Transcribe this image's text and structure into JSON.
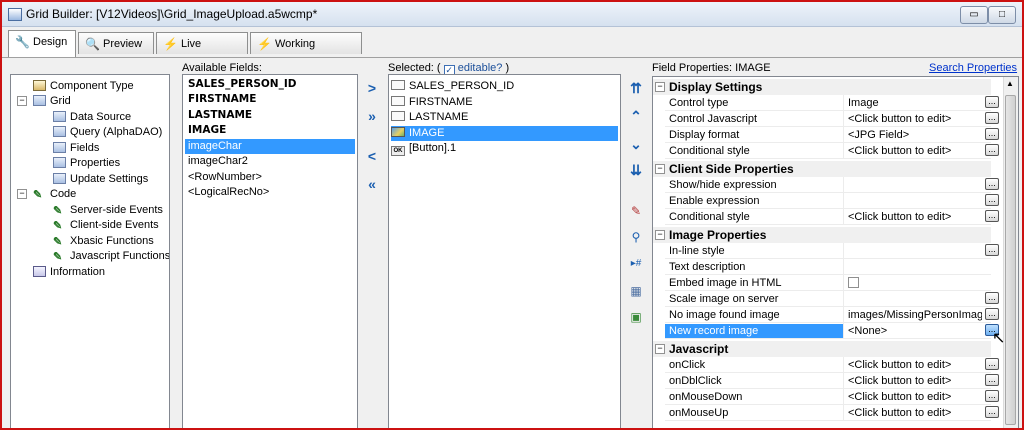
{
  "window": {
    "title": "Grid Builder: [V12Videos]\\Grid_ImageUpload.a5wcmp*",
    "buttons": [
      "▭",
      "□",
      "✕"
    ]
  },
  "tabs": [
    {
      "label": "Design",
      "icon": "wrench-icon",
      "active": true
    },
    {
      "label": "Preview",
      "icon": "preview-icon",
      "active": false
    },
    {
      "label": "Live Preview",
      "icon": "lightning-icon",
      "active": false
    },
    {
      "label": "Working Preview",
      "icon": "lightning-icon",
      "active": false
    }
  ],
  "tree": {
    "items": [
      {
        "label": "Component Type",
        "icon": "component-icon"
      },
      {
        "label": "Grid",
        "icon": "grid-icon"
      },
      {
        "label": "Data Source",
        "icon": "grid-icon"
      },
      {
        "label": "Query (AlphaDAO)",
        "icon": "grid-icon"
      },
      {
        "label": "Fields",
        "icon": "grid-icon"
      },
      {
        "label": "Properties",
        "icon": "grid-icon"
      },
      {
        "label": "Update Settings",
        "icon": "grid-icon"
      },
      {
        "label": "Code",
        "icon": "code-icon"
      },
      {
        "label": "Server-side Events",
        "icon": "code-icon"
      },
      {
        "label": "Client-side Events",
        "icon": "code-icon"
      },
      {
        "label": "Xbasic Functions",
        "icon": "code-icon"
      },
      {
        "label": "Javascript Functions",
        "icon": "code-icon"
      },
      {
        "label": "Information",
        "icon": "info-icon"
      }
    ]
  },
  "available": {
    "header": "Available Fields:",
    "items": [
      "SALES_PERSON_ID",
      "FIRSTNAME",
      "LASTNAME",
      "IMAGE",
      "imageChar",
      "imageChar2",
      "<RowNumber>",
      "<LogicalRecNo>"
    ]
  },
  "move_buttons": [
    ">",
    "»",
    "<",
    "«"
  ],
  "selected": {
    "header_prefix": "Selected: (",
    "editable_label": "editable?",
    "header_suffix": ")",
    "items": [
      "SALES_PERSON_ID",
      "FIRSTNAME",
      "LASTNAME",
      "IMAGE",
      "[Button].1"
    ]
  },
  "order_buttons": [
    "⇈",
    "⌃",
    "⌄",
    "⇊"
  ],
  "tool_icons": [
    "magic-wand-icon",
    "zoom-icon",
    "hash-icon",
    "grid-icon",
    "book-icon"
  ],
  "tool_glyphs": [
    "✎",
    "⚲",
    "▸#",
    "▦",
    "▣"
  ],
  "field_properties": {
    "header": "Field Properties: IMAGE",
    "search_label": "Search Properties",
    "ellipsis": "...",
    "sections": [
      {
        "title": "Display Settings",
        "rows": [
          {
            "name": "Control type",
            "value": "Image",
            "button": true
          },
          {
            "name": "Control Javascript",
            "value": "<Click button to edit>",
            "button": true
          },
          {
            "name": "Display format",
            "value": "<JPG Field>",
            "button": true
          },
          {
            "name": "Conditional style",
            "value": "<Click button to edit>",
            "button": true
          }
        ]
      },
      {
        "title": "Client Side Properties",
        "rows": [
          {
            "name": "Show/hide expression",
            "value": "",
            "button": true
          },
          {
            "name": "Enable expression",
            "value": "",
            "button": true
          },
          {
            "name": "Conditional style",
            "value": "<Click button to edit>",
            "button": true
          }
        ]
      },
      {
        "title": "Image Properties",
        "rows": [
          {
            "name": "In-line style",
            "value": "",
            "button": true
          },
          {
            "name": "Text description",
            "value": "",
            "button": false
          },
          {
            "name": "Embed image in HTML",
            "value": "",
            "button": false,
            "checkbox": true
          },
          {
            "name": "Scale image on server",
            "value": "",
            "button": true
          },
          {
            "name": "No image found image",
            "value": "images/MissingPersonImage.j",
            "button": true
          },
          {
            "name": "New record image",
            "value": "<None>",
            "button": true,
            "highlighted": true
          }
        ]
      },
      {
        "title": "Javascript",
        "rows": [
          {
            "name": "onClick",
            "value": "<Click button to edit>",
            "button": true
          },
          {
            "name": "onDblClick",
            "value": "<Click button to edit>",
            "button": true
          },
          {
            "name": "onMouseDown",
            "value": "<Click button to edit>",
            "button": true
          },
          {
            "name": "onMouseUp",
            "value": "<Click button to edit>",
            "button": true
          }
        ]
      }
    ]
  }
}
